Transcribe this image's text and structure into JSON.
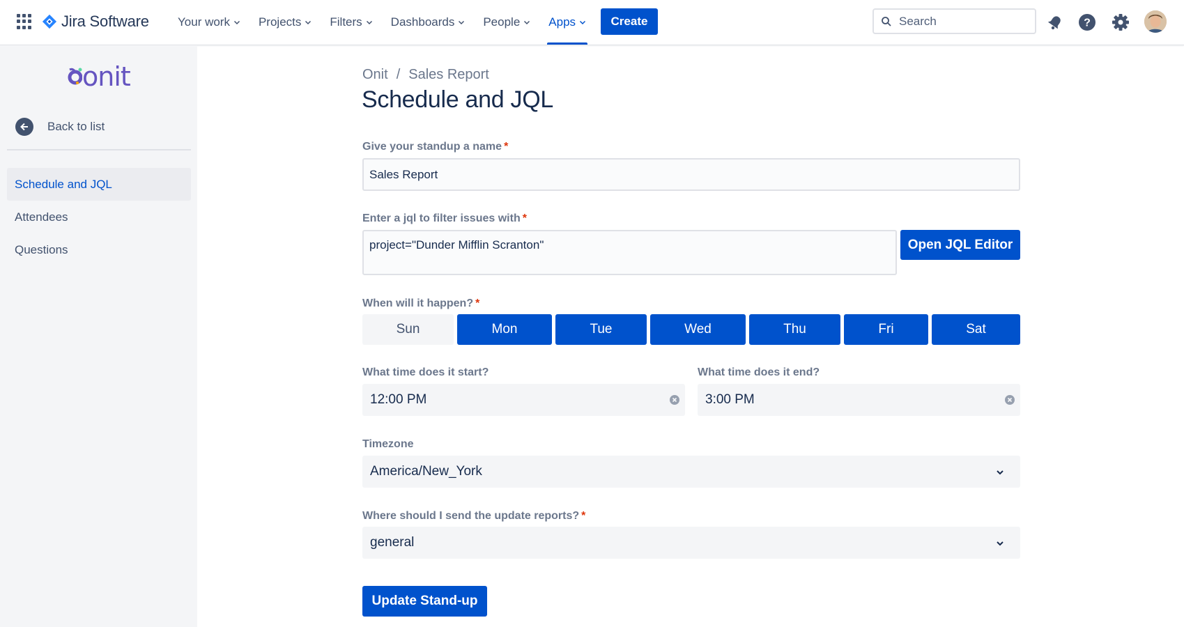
{
  "topnav": {
    "app_name": "Jira Software",
    "items": [
      {
        "label": "Your work"
      },
      {
        "label": "Projects"
      },
      {
        "label": "Filters"
      },
      {
        "label": "Dashboards"
      },
      {
        "label": "People"
      },
      {
        "label": "Apps",
        "active": true
      }
    ],
    "create_label": "Create",
    "search_placeholder": "Search",
    "icons": [
      "app-switcher-icon",
      "jira-logo-icon",
      "notifications-icon",
      "help-icon",
      "settings-icon",
      "avatar"
    ],
    "accent_color": "#0052cc"
  },
  "sidebar": {
    "brand": "onit",
    "back_label": "Back to list",
    "items": [
      {
        "label": "Schedule and JQL",
        "selected": true
      },
      {
        "label": "Attendees"
      },
      {
        "label": "Questions"
      }
    ]
  },
  "main": {
    "breadcrumb": [
      "Onit",
      "Sales Report"
    ],
    "title": "Schedule and JQL",
    "name_label": "Give your standup a name",
    "name_value": "Sales Report",
    "jql_label": "Enter a jql to filter issues with",
    "jql_value": "project=\"Dunder Mifflin Scranton\"",
    "jql_button": "Open JQL Editor",
    "schedule_label": "When will it happen?",
    "days": [
      {
        "label": "Sun",
        "selected": false
      },
      {
        "label": "Mon",
        "selected": true
      },
      {
        "label": "Tue",
        "selected": true
      },
      {
        "label": "Wed",
        "selected": true
      },
      {
        "label": "Thu",
        "selected": true
      },
      {
        "label": "Fri",
        "selected": true
      },
      {
        "label": "Sat",
        "selected": true
      }
    ],
    "start_label": "What time does it start?",
    "start_value": "12:00 PM",
    "end_label": "What time does it end?",
    "end_value": "3:00 PM",
    "timezone_label": "Timezone",
    "timezone_value": "America/New_York",
    "channel_label": "Where should I send the update reports?",
    "channel_value": "general",
    "submit_label": "Update Stand-up"
  }
}
